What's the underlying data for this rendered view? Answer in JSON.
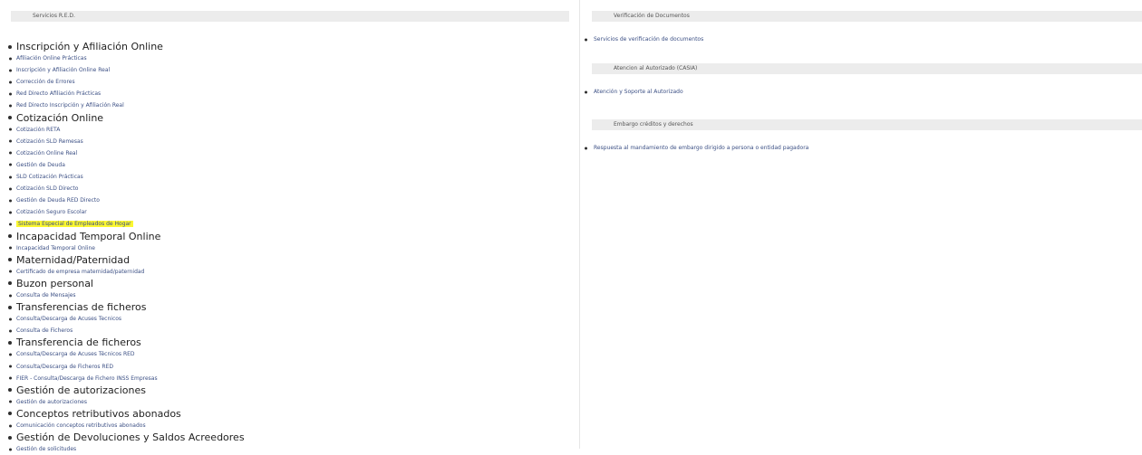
{
  "left": {
    "header": "Servicios R.E.D.",
    "categories": [
      {
        "title": "Inscripción y Afiliación Online",
        "items": [
          "Afiliación Online Prácticas",
          "Inscripción y Afiliación Online Real",
          "Corrección de Errores",
          "Red Directo Afiliación Prácticas",
          "Red Directo Inscripción y Afiliación Real"
        ]
      },
      {
        "title": "Cotización Online",
        "items": [
          "Cotización RETA",
          "Cotización SLD Remesas",
          "Cotización Online Real",
          "Gestión de Deuda",
          "SLD Cotización Prácticas",
          "Cotización SLD Directo",
          "Gestión de Deuda RED Directo",
          "Cotización Seguro Escolar",
          "Sistema Especial de Empleados de Hogar"
        ]
      },
      {
        "title": "Incapacidad Temporal Online",
        "items": [
          "Incapacidad Temporal Online"
        ]
      },
      {
        "title": "Maternidad/Paternidad",
        "items": [
          "Certificado de empresa maternidad/paternidad"
        ]
      },
      {
        "title": "Buzon personal",
        "items": [
          "Consulta de Mensajes"
        ]
      },
      {
        "title": "Transferencias de ficheros",
        "items": [
          "Consulta/Descarga de Acuses Tecnicos",
          "Consulta de Ficheros"
        ]
      },
      {
        "title": "Transferencia de ficheros",
        "items": [
          "Consulta/Descarga de Acuses Técnicos RED",
          "Consulta/Descarga de Ficheros RED",
          "FIER - Consulta/Descarga de Fichero INSS Empresas"
        ]
      },
      {
        "title": "Gestión de autorizaciones",
        "items": [
          "Gestión de autorizaciones"
        ]
      },
      {
        "title": "Conceptos retributivos abonados",
        "items": [
          "Comunicación conceptos retributivos abonados"
        ]
      },
      {
        "title": "Gestión de Devoluciones y Saldos Acreedores",
        "items": [
          "Gestión de solicitudes"
        ]
      }
    ],
    "highlighted_item": "Sistema Especial de Empleados de Hogar"
  },
  "right": {
    "sections": [
      {
        "header": "Verificación de Documentos",
        "items": [
          "Servicios de verificación de documentos"
        ]
      },
      {
        "header": "Atencion al Autorizado (CASIA)",
        "items": [
          "Atención y Soporte al Autorizado"
        ]
      },
      {
        "header": "Embargo créditos y derechos",
        "items": [
          "Respuesta al mandamiento de embargo dirigido a persona o entidad pagadora"
        ]
      }
    ]
  },
  "colors": {
    "link": "#3b4f84",
    "highlight": "#fbf731",
    "header_bg": "#ececec"
  }
}
